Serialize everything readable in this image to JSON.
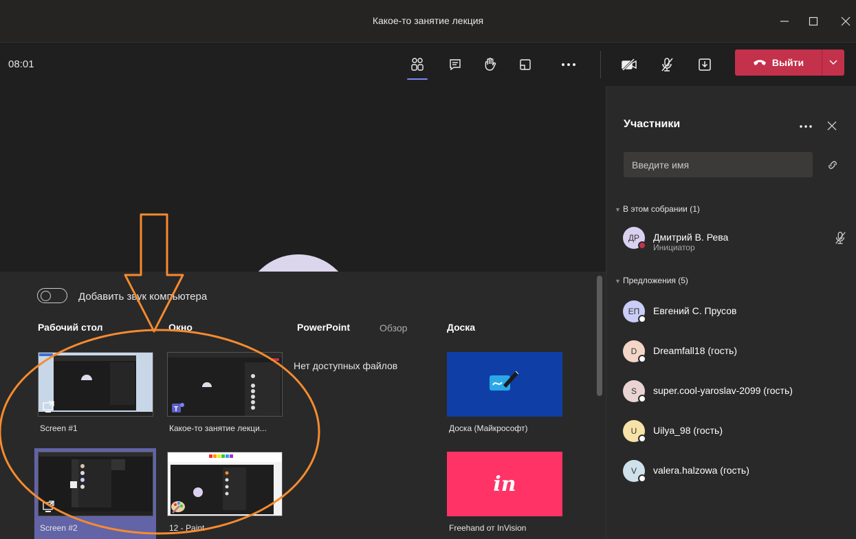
{
  "window": {
    "title": "Какое-то занятие лекция"
  },
  "toolbar": {
    "timer": "08:01",
    "leave_label": "Выйти"
  },
  "share_tray": {
    "sound_label": "Добавить звук компьютера",
    "sections": {
      "desktop": "Рабочий стол",
      "window": "Окно",
      "powerpoint": "PowerPoint",
      "browse": "Обзор",
      "whiteboard": "Доска"
    },
    "no_files": "Нет доступных файлов",
    "desktop_items": [
      {
        "label": "Screen #1"
      },
      {
        "label": "Screen #2"
      }
    ],
    "window_items": [
      {
        "label": "Какое-то занятие лекци..."
      },
      {
        "label": "12 - Paint"
      }
    ],
    "whiteboard_items": [
      {
        "label": "Доска (Майкрософт)",
        "color": "#0f3fa6"
      },
      {
        "label": "Freehand от InVision",
        "color": "#ff3366",
        "logo": "in"
      }
    ],
    "selected_color": "#6264a7"
  },
  "panel": {
    "title": "Участники",
    "search_placeholder": "Введите имя",
    "in_meeting_header": "В этом собрании (1)",
    "suggestions_header": "Предложения (5)",
    "in_meeting": [
      {
        "initials": "ДР",
        "name": "Дмитрий В. Рева",
        "role": "Инициатор",
        "color": "#d9d1ef"
      }
    ],
    "suggestions": [
      {
        "initials": "ЕП",
        "name": "Евгений С. Прусов",
        "color": "#c9cdf7"
      },
      {
        "initials": "D",
        "name": "Dreamfall18 (гость)",
        "color": "#f3d6c8"
      },
      {
        "initials": "S",
        "name": "super.cool-yaroslav-2099 (гость)",
        "color": "#ead3d3"
      },
      {
        "initials": "U",
        "name": "Uilya_98 (гость)",
        "color": "#f7e2a8"
      },
      {
        "initials": "V",
        "name": "valera.halzowa (гость)",
        "color": "#cfe1ea"
      }
    ]
  },
  "colors": {
    "accent": "#7f85f5",
    "leave": "#c4314b",
    "annotation": "#f68b2f"
  }
}
